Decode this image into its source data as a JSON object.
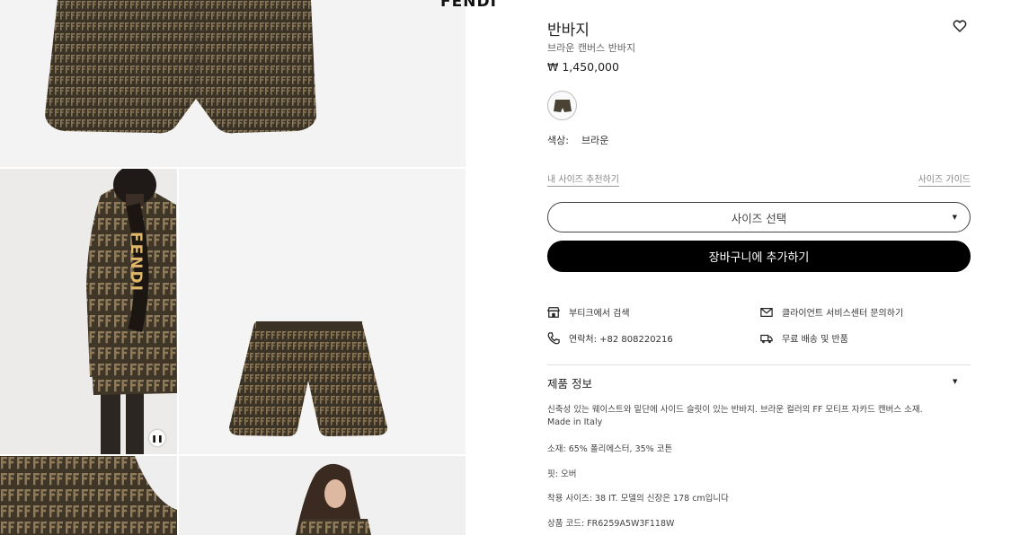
{
  "brand": {
    "logo_text": "FENDI"
  },
  "product": {
    "title": "반바지",
    "subtitle": "브라운 캔버스 반바지",
    "price": "₩ 1,450,000",
    "color_label": "색상:",
    "color_value": "브라운"
  },
  "links": {
    "size_recommend": "내 사이즈 추천하기",
    "size_guide": "사이즈 가이드"
  },
  "size_select": {
    "placeholder": "사이즈 선택"
  },
  "cart_button": {
    "label": "장바구니에 추가하기"
  },
  "services": [
    {
      "icon": "store-icon",
      "label": "부티크에서 검색"
    },
    {
      "icon": "mail-icon",
      "label": "클라이언트 서비스센터 문의하기"
    },
    {
      "icon": "phone-icon",
      "label": "연락처: +82 808220216"
    },
    {
      "icon": "truck-return-icon",
      "label": "무료 배송 및 반품"
    }
  ],
  "product_info": {
    "heading": "제품 정보",
    "description": "신축성 있는 웨이스트와 밑단에 사이드 슬릿이 있는 반바지. 브라운 컬러의 FF 모티프 자카드 캔버스 소재.",
    "origin": "Made in Italy",
    "material": "소재: 65% 폴리에스터, 35% 코튼",
    "fit": "핏: 오버",
    "model_size": "착용 사이즈: 38 IT. 모델의 신장은 178 cm입니다",
    "product_code": "상품 코드: FR6259A5W3F118W"
  },
  "colors": {
    "accent": "#000000",
    "fabric_dark": "#3b3325",
    "fabric_light": "#8a7657"
  },
  "gallery": {
    "bag_text": "FENDI"
  }
}
